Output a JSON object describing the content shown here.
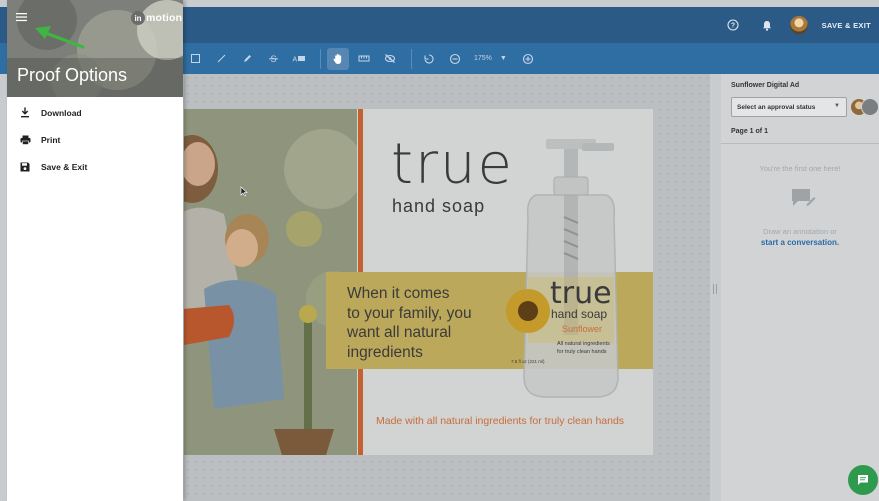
{
  "topbar": {
    "save_exit_label": "SAVE & EXIT",
    "help_icon": "help-icon",
    "bell_icon": "bell-icon",
    "bg_color": "#2c5a86"
  },
  "toolbar": {
    "tools": [
      "square-icon",
      "line-icon",
      "pen-icon",
      "strikethrough-icon",
      "text-replace-icon",
      "hand-icon",
      "ruler-icon",
      "hide-icon",
      "rotate-icon",
      "zoom-out-icon",
      "zoom-in-icon"
    ],
    "active_tool": "hand-icon",
    "zoom_value": "175%",
    "bg_color": "#2f6ea3"
  },
  "ad": {
    "brand": "true",
    "brand_sub": "hand soap",
    "headline_lines": [
      "When it comes",
      "to your family, you",
      "want all natural",
      "ingredients"
    ],
    "bottle_label": {
      "brand": "true",
      "sub": "hand soap",
      "flavor": "Sunflower",
      "desc_lines": [
        "All natural ingredients",
        "for truly clean hands"
      ],
      "size": "7.5 fl oz (221 ml)"
    },
    "footer": "Made with all natural ingredients for truly clean hands",
    "accent_color": "#c4622f"
  },
  "rightpanel": {
    "title": "Sunflower Digital Ad",
    "approval_placeholder": "Select an approval status",
    "page_label": "Page 1 of 1",
    "first_one": "You're the first one here!",
    "draw_prompt": "Draw an annotation or",
    "start_link": "start a conversation.",
    "link_color": "#2a6aa8"
  },
  "drawer": {
    "logo_text": "motion",
    "logo_mark": "in",
    "title": "Proof Options",
    "items": [
      {
        "label": "Download",
        "icon": "download-icon"
      },
      {
        "label": "Print",
        "icon": "print-icon"
      },
      {
        "label": "Save & Exit",
        "icon": "save-icon"
      }
    ]
  },
  "fab": {
    "icon": "chat-icon",
    "color": "#2f9a4e"
  }
}
